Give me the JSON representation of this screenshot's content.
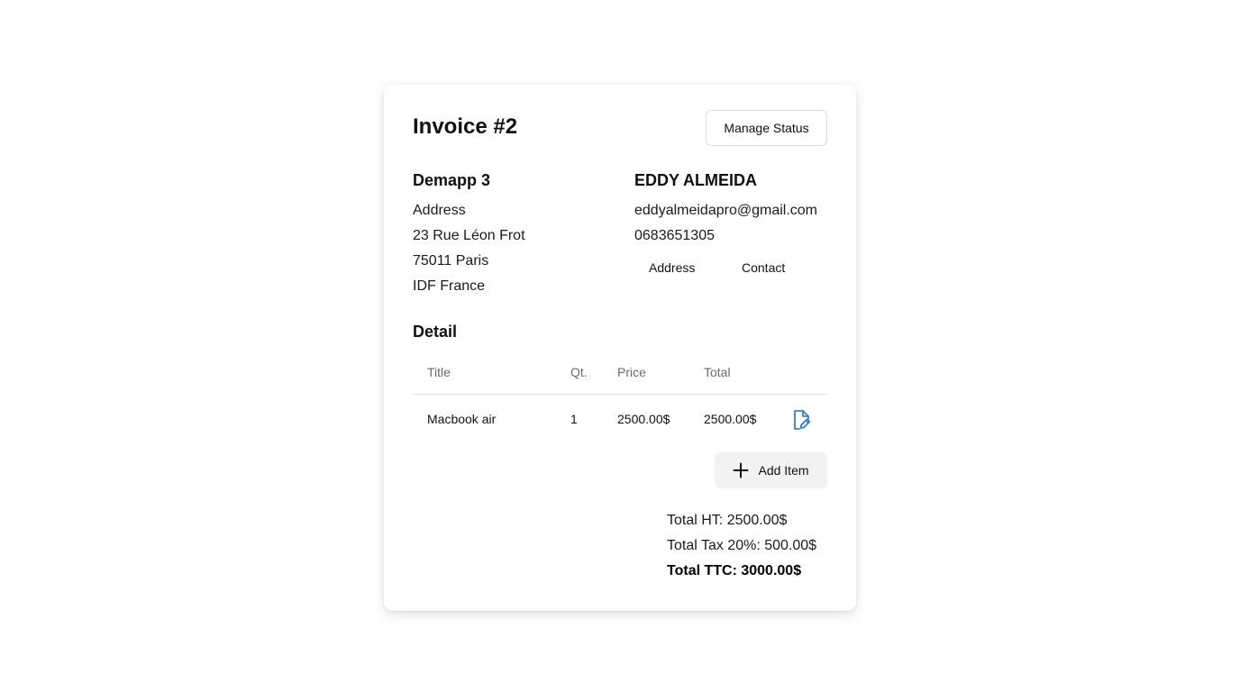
{
  "invoice": {
    "title": "Invoice #2",
    "manage_status_label": "Manage Status"
  },
  "company": {
    "name": "Demapp 3",
    "address_label": "Address",
    "street": "23 Rue Léon Frot",
    "city": "75011 Paris",
    "region": "IDF France"
  },
  "client": {
    "name": "EDDY ALMEIDA",
    "email": "eddyalmeidapro@gmail.com",
    "phone": "0683651305",
    "tabs": [
      "Address",
      "Contact"
    ]
  },
  "detail": {
    "title": "Detail",
    "columns": [
      "Title",
      "Qt.",
      "Price",
      "Total"
    ],
    "rows": [
      {
        "title": "Macbook air",
        "qty": "1",
        "price": "2500.00$",
        "total": "2500.00$"
      }
    ],
    "add_item_label": "Add Item"
  },
  "totals": {
    "ht": "Total HT: 2500.00$",
    "tax": "Total Tax 20%: 500.00$",
    "ttc": "Total TTC: 3000.00$"
  },
  "colors": {
    "edit_icon": "#3b7ed0",
    "add_button_bg": "#f2f2f2"
  },
  "icons": {
    "edit": "file-edit-icon",
    "add": "plus-icon"
  }
}
